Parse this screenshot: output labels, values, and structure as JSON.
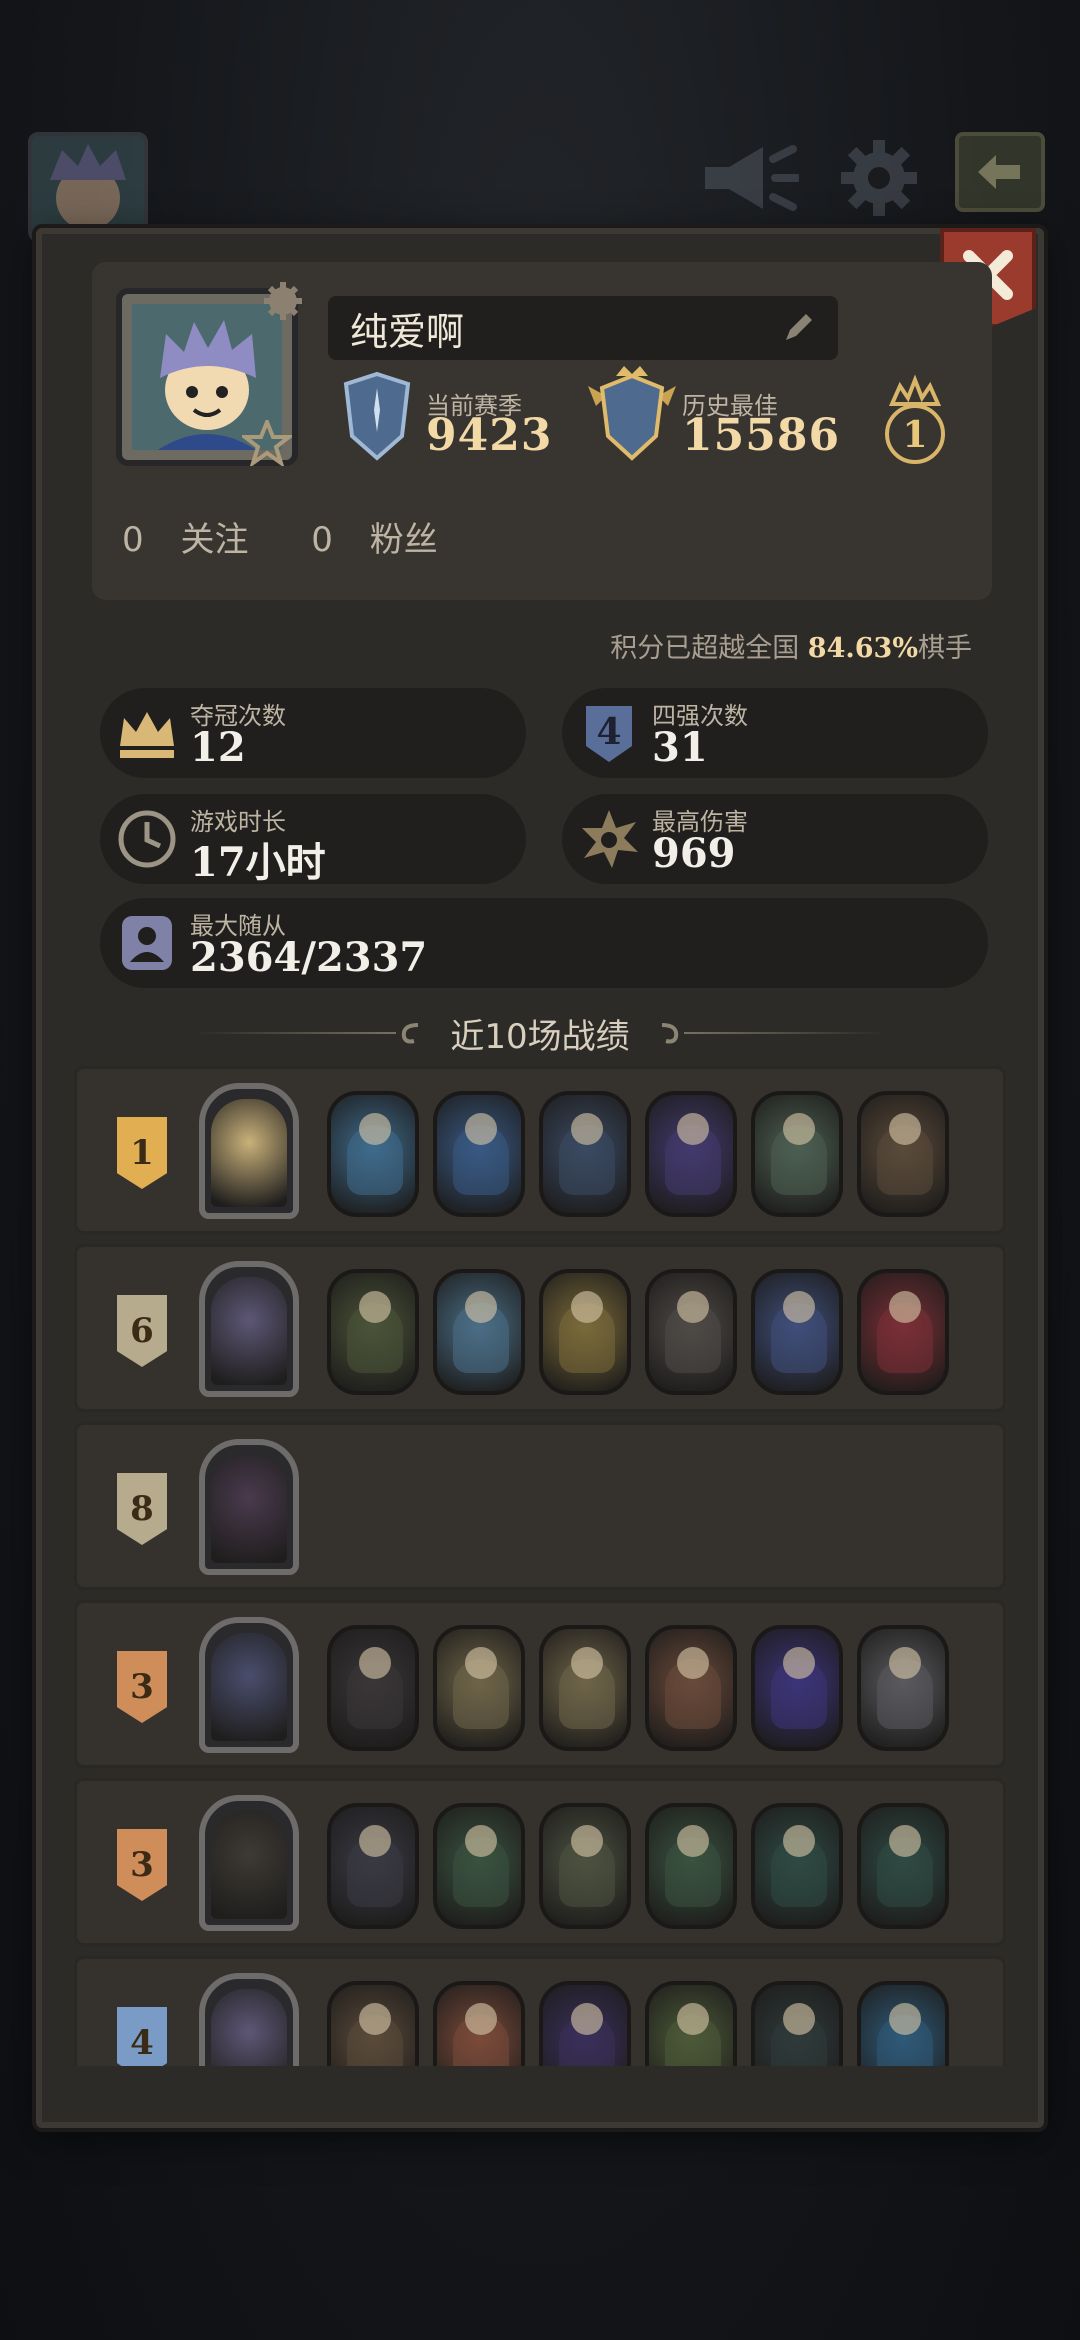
{
  "profile": {
    "name": "纯爱啊",
    "current_season_label": "当前赛季",
    "current_season_value": "9423",
    "best_label": "历史最佳",
    "best_value": "15586",
    "rank_badge": "1",
    "follow_count": "0",
    "follow_label": "关注",
    "fans_count": "0",
    "fans_label": "粉丝"
  },
  "exceed": {
    "prefix": "积分已超越全国",
    "percent": "84.63%",
    "suffix": "棋手"
  },
  "stats": {
    "champion_label": "夺冠次数",
    "champion_value": "12",
    "top4_label": "四强次数",
    "top4_value": "31",
    "playtime_label": "游戏时长",
    "playtime_value": "17小时",
    "maxdmg_label": "最高伤害",
    "maxdmg_value": "969",
    "maxfollow_label": "最大随从",
    "maxfollow_value": "2364/2337",
    "top4_icon_text": "4"
  },
  "recent": {
    "title": "近10场战绩"
  },
  "records": [
    {
      "rank": "1",
      "rank_color": "#e2ae52",
      "hero_color": "#c9b17a",
      "units": [
        "#3f6b8c",
        "#395a84",
        "#3b4a63",
        "#433a6e",
        "#4d5f52",
        "#5a4a3a"
      ]
    },
    {
      "rank": "6",
      "rank_color": "#b6ab8c",
      "hero_color": "#5d5776",
      "units": [
        "#4a5338",
        "#4a6e86",
        "#7a6a3a",
        "#4f4a47",
        "#3f4f7a",
        "#7a2f36"
      ]
    },
    {
      "rank": "8",
      "rank_color": "#b6ab8c",
      "hero_color": "#4a3a4e",
      "units": []
    },
    {
      "rank": "3",
      "rank_color": "#cf8d5a",
      "hero_color": "#4a4e6e",
      "units": [
        "#3a3638",
        "#6e6448",
        "#6e6448",
        "#6a4a3a",
        "#3c3478",
        "#5a5a5e"
      ]
    },
    {
      "rank": "3",
      "rank_color": "#cf8d5a",
      "hero_color": "#3e3a34",
      "units": [
        "#3a3a44",
        "#3a5240",
        "#4c5240",
        "#3a5240",
        "#2f4a44",
        "#2f4a44"
      ]
    },
    {
      "rank": "4",
      "rank_color": "#7a9bc6",
      "hero_color": "#5d5776",
      "units": [
        "#5a4a3a",
        "#7a4a3a",
        "#3a2f5a",
        "#4c5a38",
        "#2f3a3a",
        "#2f5a78"
      ]
    }
  ],
  "icons": [
    "megaphone-icon",
    "gear-icon",
    "exit-icon",
    "close-icon",
    "pencil-icon",
    "shield-season-icon",
    "shield-best-icon",
    "crown-rank-icon",
    "crown-icon",
    "top4-icon",
    "clock-icon",
    "burst-icon",
    "follower-icon"
  ]
}
